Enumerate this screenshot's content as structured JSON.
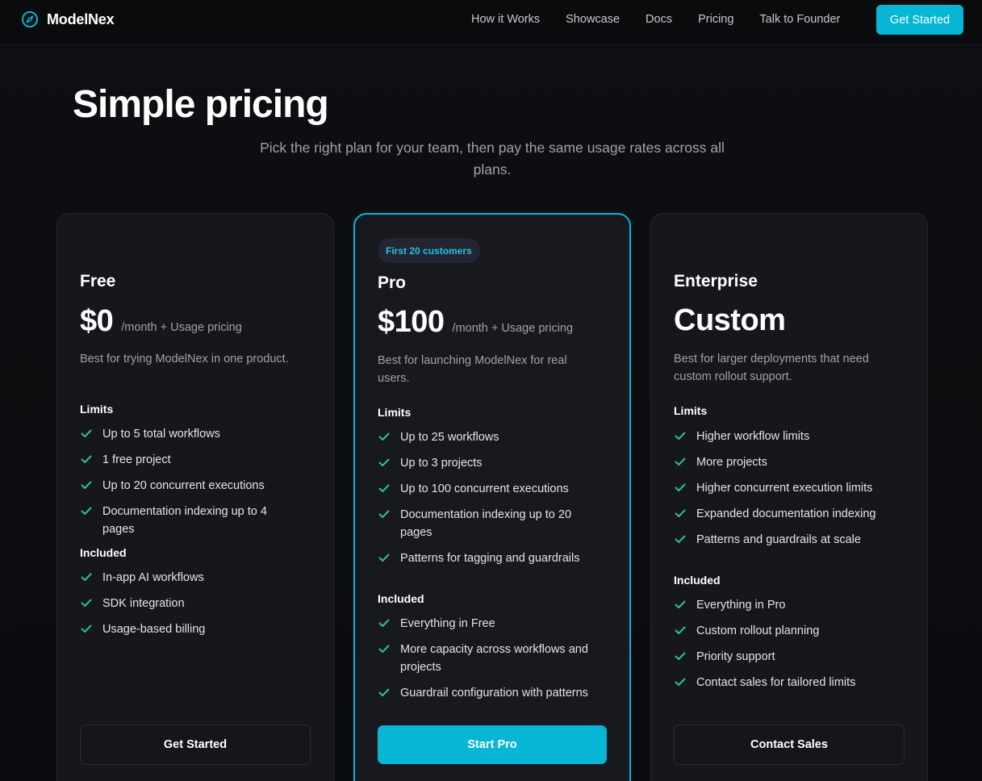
{
  "nav": {
    "brand": "ModelNex",
    "links": [
      "How it Works",
      "Showcase",
      "Docs",
      "Pricing",
      "Talk to Founder"
    ],
    "cta": "Get Started"
  },
  "hero": {
    "title": "Simple pricing",
    "subtitle": "Pick the right plan for your team, then pay the same usage rates across all plans."
  },
  "plans": {
    "free": {
      "name": "Free",
      "price": "$0",
      "price_note": "/month + Usage pricing",
      "description": "Best for trying ModelNex in one product.",
      "limits_label": "Limits",
      "limits": [
        "Up to 5 total workflows",
        "1 free project",
        "Up to 20 concurrent executions",
        "Documentation indexing up to 4 pages"
      ],
      "included_label": "Included",
      "included": [
        "In-app AI workflows",
        "SDK integration",
        "Usage-based billing"
      ],
      "button": "Get Started"
    },
    "pro": {
      "badge": "First 20 customers",
      "name": "Pro",
      "price": "$100",
      "price_note": "/month + Usage pricing",
      "description": "Best for launching ModelNex for real users.",
      "limits_label": "Limits",
      "limits": [
        "Up to 25 workflows",
        "Up to 3 projects",
        "Up to 100 concurrent executions",
        "Documentation indexing up to 20 pages",
        "Patterns for tagging and guardrails"
      ],
      "included_label": "Included",
      "included": [
        "Everything in Free",
        "More capacity across workflows and projects",
        "Guardrail configuration with patterns"
      ],
      "button": "Start Pro"
    },
    "enterprise": {
      "name": "Enterprise",
      "price": "Custom",
      "description": "Best for larger deployments that need custom rollout support.",
      "limits_label": "Limits",
      "limits": [
        "Higher workflow limits",
        "More projects",
        "Higher concurrent execution limits",
        "Expanded documentation indexing",
        "Patterns and guardrails at scale"
      ],
      "included_label": "Included",
      "included": [
        "Everything in Pro",
        "Custom rollout planning",
        "Priority support",
        "Contact sales for tailored limits"
      ],
      "button": "Contact Sales"
    }
  },
  "colors": {
    "accent": "#06b6d4",
    "check": "#2ec28f",
    "background": "#0c0d10",
    "card": "#16171b"
  },
  "icons": {
    "brand": "compass-icon",
    "feature": "check-icon"
  }
}
